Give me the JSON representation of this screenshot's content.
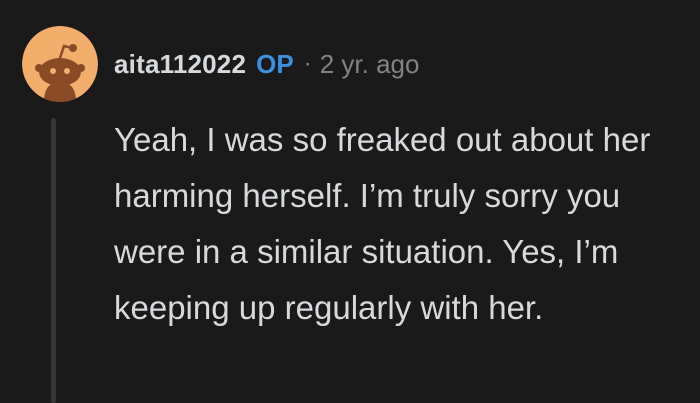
{
  "comment": {
    "author": "aita112022",
    "badge": "OP",
    "separator": "·",
    "timestamp": "2 yr. ago",
    "body": "Yeah, I was so freaked out about her harming herself. I’m truly sorry you were in a similar situation. Yes, I’m keeping up regularly with her."
  },
  "avatar": {
    "icon": "snoo-avatar-icon",
    "background_color": "#f2ae6a"
  },
  "colors": {
    "background": "#1a1a1b",
    "text": "#d7dadc",
    "muted": "#818384",
    "op_badge": "#3d8fe0",
    "thread_line": "#343536"
  }
}
